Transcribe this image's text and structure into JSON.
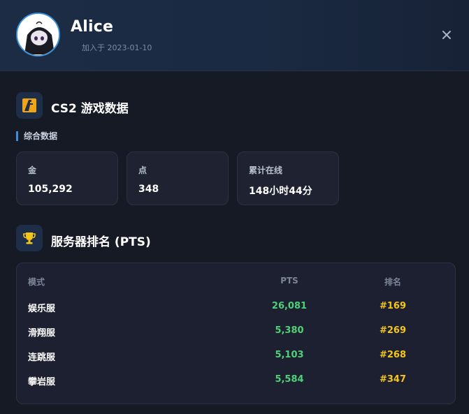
{
  "header": {
    "user_name": "Alice",
    "join_date": "加入于 2023-01-10",
    "close_icon": "close-icon"
  },
  "cs2_section": {
    "title": "CS2 游戏数据",
    "icon": "cs2-logo-icon",
    "subheading": "综合数据",
    "stats": [
      {
        "label": "金",
        "value": "105,292"
      },
      {
        "label": "点",
        "value": "348"
      },
      {
        "label": "累计在线",
        "value": "148小时44分"
      }
    ]
  },
  "ranking_section": {
    "title": "服务器排名 (PTS)",
    "icon": "trophy-icon",
    "columns": {
      "mode": "模式",
      "pts": "PTS",
      "rank": "排名"
    },
    "rows": [
      {
        "mode": "娱乐服",
        "pts": "26,081",
        "rank": "#169"
      },
      {
        "mode": "滑翔服",
        "pts": "5,380",
        "rank": "#269"
      },
      {
        "mode": "连跳服",
        "pts": "5,103",
        "rank": "#268"
      },
      {
        "mode": "攀岩服",
        "pts": "5,584",
        "rank": "#347"
      }
    ]
  },
  "colors": {
    "accent": "#3a8fd8",
    "pts_green": "#4fd178",
    "rank_gold": "#f5c518",
    "background": "#161a24"
  }
}
